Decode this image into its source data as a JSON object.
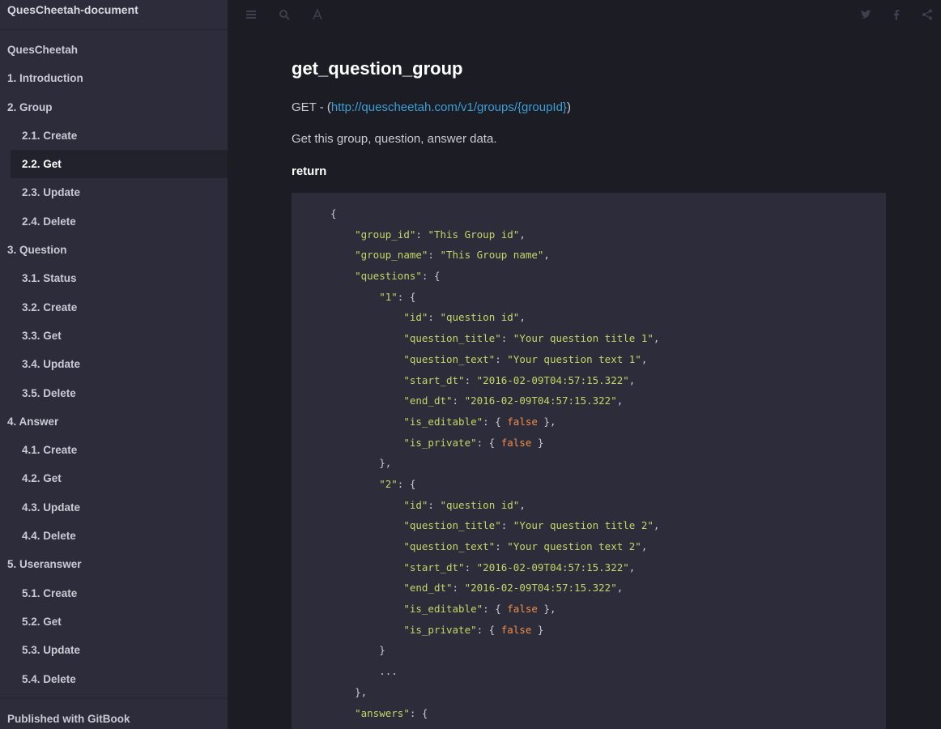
{
  "sidebar": {
    "brand": "QuesCheetah-document",
    "items": [
      {
        "label": "QuesCheetah",
        "level": 1
      },
      {
        "label": "1. Introduction",
        "level": 1
      },
      {
        "label": "2. Group",
        "level": 1
      },
      {
        "label": "2.1. Create",
        "level": 2
      },
      {
        "label": "2.2. Get",
        "level": 2,
        "active": true
      },
      {
        "label": "2.3. Update",
        "level": 2
      },
      {
        "label": "2.4. Delete",
        "level": 2
      },
      {
        "label": "3. Question",
        "level": 1
      },
      {
        "label": "3.1. Status",
        "level": 2
      },
      {
        "label": "3.2. Create",
        "level": 2
      },
      {
        "label": "3.3. Get",
        "level": 2
      },
      {
        "label": "3.4. Update",
        "level": 2
      },
      {
        "label": "3.5. Delete",
        "level": 2
      },
      {
        "label": "4. Answer",
        "level": 1
      },
      {
        "label": "4.1. Create",
        "level": 2
      },
      {
        "label": "4.2. Get",
        "level": 2
      },
      {
        "label": "4.3. Update",
        "level": 2
      },
      {
        "label": "4.4. Delete",
        "level": 2
      },
      {
        "label": "5. Useranswer",
        "level": 1
      },
      {
        "label": "5.1. Create",
        "level": 2
      },
      {
        "label": "5.2. Get",
        "level": 2
      },
      {
        "label": "5.3. Update",
        "level": 2
      },
      {
        "label": "5.4. Delete",
        "level": 2
      }
    ],
    "footer": "Published with GitBook"
  },
  "toolbar": {
    "left_icons": [
      "menu-icon",
      "search-icon",
      "font-settings-icon"
    ],
    "right_icons": [
      "twitter-icon",
      "facebook-icon",
      "share-icon"
    ]
  },
  "page": {
    "title": "get_question_group",
    "method_prefix": "GET - (",
    "url": "http://quescheetah.com/v1/groups/{groupId}",
    "method_suffix": ")",
    "description": "Get this group, question, answer data.",
    "return_heading": "return"
  },
  "code": {
    "lines": [
      [
        {
          "t": "{",
          "c": "p"
        }
      ],
      [
        {
          "t": "    ",
          "c": "p"
        },
        {
          "t": "\"group_id\"",
          "c": "k"
        },
        {
          "t": ": ",
          "c": "p"
        },
        {
          "t": "\"This Group id\"",
          "c": "s"
        },
        {
          "t": ",",
          "c": "p"
        }
      ],
      [
        {
          "t": "    ",
          "c": "p"
        },
        {
          "t": "\"group_name\"",
          "c": "k"
        },
        {
          "t": ": ",
          "c": "p"
        },
        {
          "t": "\"This Group name\"",
          "c": "s"
        },
        {
          "t": ",",
          "c": "p"
        }
      ],
      [
        {
          "t": "    ",
          "c": "p"
        },
        {
          "t": "\"questions\"",
          "c": "k"
        },
        {
          "t": ": {",
          "c": "p"
        }
      ],
      [
        {
          "t": "        ",
          "c": "p"
        },
        {
          "t": "\"1\"",
          "c": "k"
        },
        {
          "t": ": {",
          "c": "p"
        }
      ],
      [
        {
          "t": "            ",
          "c": "p"
        },
        {
          "t": "\"id\"",
          "c": "k"
        },
        {
          "t": ": ",
          "c": "p"
        },
        {
          "t": "\"question id\"",
          "c": "s"
        },
        {
          "t": ",",
          "c": "p"
        }
      ],
      [
        {
          "t": "            ",
          "c": "p"
        },
        {
          "t": "\"question_title\"",
          "c": "k"
        },
        {
          "t": ": ",
          "c": "p"
        },
        {
          "t": "\"Your question title 1\"",
          "c": "s"
        },
        {
          "t": ",",
          "c": "p"
        }
      ],
      [
        {
          "t": "            ",
          "c": "p"
        },
        {
          "t": "\"question_text\"",
          "c": "k"
        },
        {
          "t": ": ",
          "c": "p"
        },
        {
          "t": "\"Your question text 1\"",
          "c": "s"
        },
        {
          "t": ",",
          "c": "p"
        }
      ],
      [
        {
          "t": "            ",
          "c": "p"
        },
        {
          "t": "\"start_dt\"",
          "c": "k"
        },
        {
          "t": ": ",
          "c": "p"
        },
        {
          "t": "\"2016-02-09T04:57:15.322\"",
          "c": "s"
        },
        {
          "t": ",",
          "c": "p"
        }
      ],
      [
        {
          "t": "            ",
          "c": "p"
        },
        {
          "t": "\"end_dt\"",
          "c": "k"
        },
        {
          "t": ": ",
          "c": "p"
        },
        {
          "t": "\"2016-02-09T04:57:15.322\"",
          "c": "s"
        },
        {
          "t": ",",
          "c": "p"
        }
      ],
      [
        {
          "t": "            ",
          "c": "p"
        },
        {
          "t": "\"is_editable\"",
          "c": "k"
        },
        {
          "t": ": { ",
          "c": "p"
        },
        {
          "t": "false",
          "c": "b"
        },
        {
          "t": " },",
          "c": "p"
        }
      ],
      [
        {
          "t": "            ",
          "c": "p"
        },
        {
          "t": "\"is_private\"",
          "c": "k"
        },
        {
          "t": ": { ",
          "c": "p"
        },
        {
          "t": "false",
          "c": "b"
        },
        {
          "t": " }",
          "c": "p"
        }
      ],
      [
        {
          "t": "        },",
          "c": "p"
        }
      ],
      [
        {
          "t": "        ",
          "c": "p"
        },
        {
          "t": "\"2\"",
          "c": "k"
        },
        {
          "t": ": {",
          "c": "p"
        }
      ],
      [
        {
          "t": "            ",
          "c": "p"
        },
        {
          "t": "\"id\"",
          "c": "k"
        },
        {
          "t": ": ",
          "c": "p"
        },
        {
          "t": "\"question id\"",
          "c": "s"
        },
        {
          "t": ",",
          "c": "p"
        }
      ],
      [
        {
          "t": "            ",
          "c": "p"
        },
        {
          "t": "\"question_title\"",
          "c": "k"
        },
        {
          "t": ": ",
          "c": "p"
        },
        {
          "t": "\"Your question title 2\"",
          "c": "s"
        },
        {
          "t": ",",
          "c": "p"
        }
      ],
      [
        {
          "t": "            ",
          "c": "p"
        },
        {
          "t": "\"question_text\"",
          "c": "k"
        },
        {
          "t": ": ",
          "c": "p"
        },
        {
          "t": "\"Your question text 2\"",
          "c": "s"
        },
        {
          "t": ",",
          "c": "p"
        }
      ],
      [
        {
          "t": "            ",
          "c": "p"
        },
        {
          "t": "\"start_dt\"",
          "c": "k"
        },
        {
          "t": ": ",
          "c": "p"
        },
        {
          "t": "\"2016-02-09T04:57:15.322\"",
          "c": "s"
        },
        {
          "t": ",",
          "c": "p"
        }
      ],
      [
        {
          "t": "            ",
          "c": "p"
        },
        {
          "t": "\"end_dt\"",
          "c": "k"
        },
        {
          "t": ": ",
          "c": "p"
        },
        {
          "t": "\"2016-02-09T04:57:15.322\"",
          "c": "s"
        },
        {
          "t": ",",
          "c": "p"
        }
      ],
      [
        {
          "t": "            ",
          "c": "p"
        },
        {
          "t": "\"is_editable\"",
          "c": "k"
        },
        {
          "t": ": { ",
          "c": "p"
        },
        {
          "t": "false",
          "c": "b"
        },
        {
          "t": " },",
          "c": "p"
        }
      ],
      [
        {
          "t": "            ",
          "c": "p"
        },
        {
          "t": "\"is_private\"",
          "c": "k"
        },
        {
          "t": ": { ",
          "c": "p"
        },
        {
          "t": "false",
          "c": "b"
        },
        {
          "t": " }",
          "c": "p"
        }
      ],
      [
        {
          "t": "        }",
          "c": "p"
        }
      ],
      [
        {
          "t": "        ...",
          "c": "p"
        }
      ],
      [
        {
          "t": "    },",
          "c": "p"
        }
      ],
      [
        {
          "t": "    ",
          "c": "p"
        },
        {
          "t": "\"answers\"",
          "c": "k"
        },
        {
          "t": ": {",
          "c": "p"
        }
      ]
    ]
  },
  "colors": {
    "sidebar_bg": "#2c2c3a",
    "main_bg": "#1c1c24",
    "link": "#3b9fd6",
    "string": "#c6d567",
    "boolean": "#f08d49"
  }
}
